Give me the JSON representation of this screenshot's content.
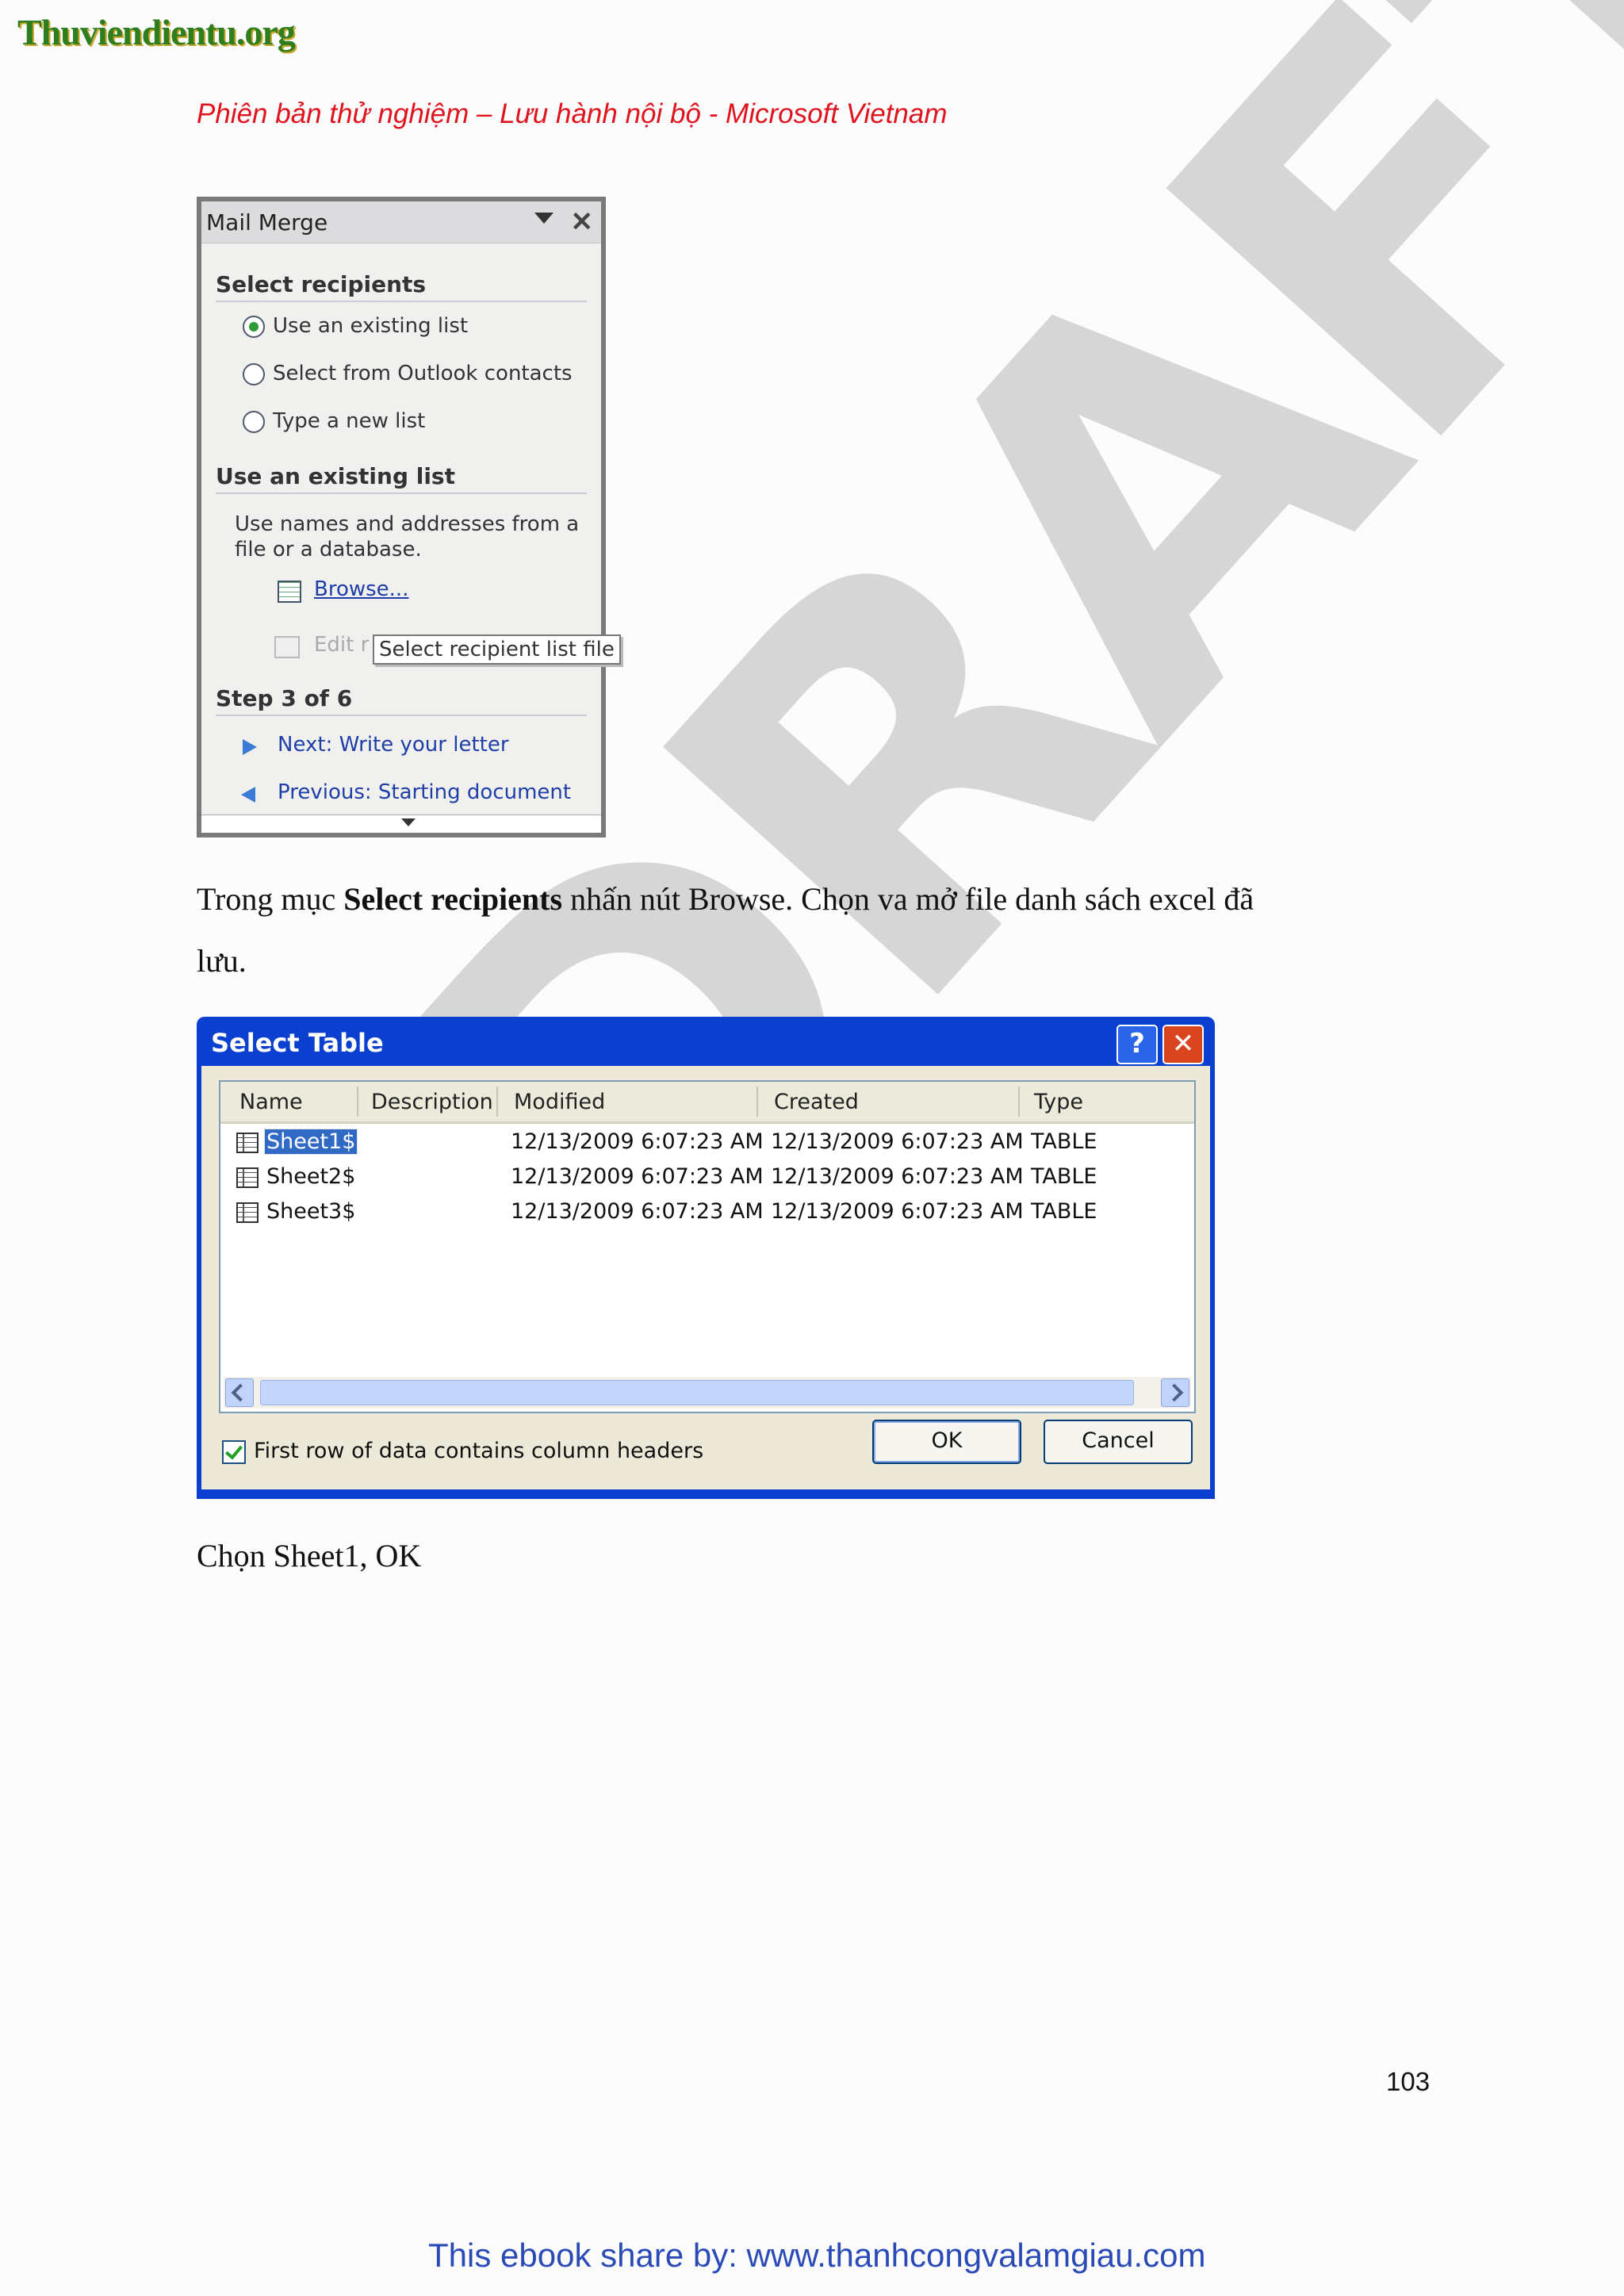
{
  "header": {
    "site_logo": "Thuviendientu.org",
    "note": "Phiên bản thử nghiệm – Lưu hành nội bộ - Microsoft Vietnam"
  },
  "watermark": "DRAFT",
  "mail_merge": {
    "title": "Mail Merge",
    "section_select": "Select recipients",
    "options": [
      {
        "label": "Use an existing list",
        "selected": true
      },
      {
        "label": "Select from Outlook contacts",
        "selected": false
      },
      {
        "label": "Type a new list",
        "selected": false
      }
    ],
    "section_existing": "Use an existing list",
    "desc_line1": "Use names and addresses from a",
    "desc_line2": "file or a database.",
    "browse": "Browse...",
    "edit": "Edit r",
    "tooltip": "Select recipient list file",
    "step": "Step 3 of 6",
    "next": "Next: Write your letter",
    "previous": "Previous: Starting document"
  },
  "paragraph1": {
    "pre": "Trong mục ",
    "bold": "Select recipients",
    "post": " nhấn nút Browse. Chọn va mở file danh sách excel đã",
    "line2": "lưu."
  },
  "dialog": {
    "title": "Select Table",
    "help": "?",
    "columns": [
      "Name",
      "Description",
      "Modified",
      "Created",
      "Type"
    ],
    "rows": [
      {
        "name": "Sheet1$",
        "description": "",
        "modified": "12/13/2009 6:07:23 AM",
        "created": "12/13/2009 6:07:23 AM",
        "type": "TABLE",
        "selected": true
      },
      {
        "name": "Sheet2$",
        "description": "",
        "modified": "12/13/2009 6:07:23 AM",
        "created": "12/13/2009 6:07:23 AM",
        "type": "TABLE",
        "selected": false
      },
      {
        "name": "Sheet3$",
        "description": "",
        "modified": "12/13/2009 6:07:23 AM",
        "created": "12/13/2009 6:07:23 AM",
        "type": "TABLE",
        "selected": false
      }
    ],
    "checkbox_label": "First row of data contains column headers",
    "checkbox_checked": true,
    "ok": "OK",
    "cancel": "Cancel"
  },
  "paragraph2": "Chọn Sheet1, OK",
  "page_number": "103",
  "footer": "This ebook share by: www.thanhcongvalamgiau.com"
}
